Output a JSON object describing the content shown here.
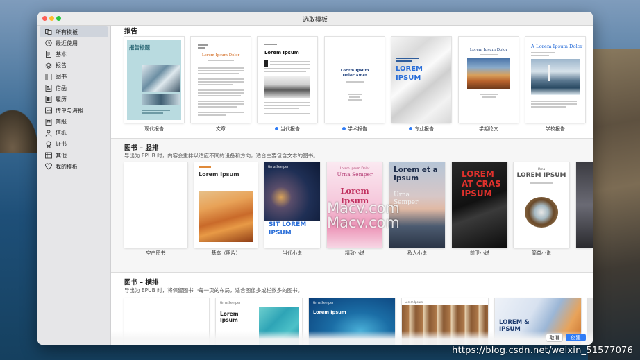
{
  "window": {
    "title": "选取模板",
    "buttons": {
      "cancel": "取消",
      "create": "创建"
    }
  },
  "sidebar": {
    "items": [
      {
        "label": "所有模板",
        "icon": "all-templates-icon",
        "active": true
      },
      {
        "label": "最近使用",
        "icon": "clock-icon"
      },
      {
        "label": "基本",
        "icon": "document-icon"
      },
      {
        "label": "报告",
        "icon": "stack-icon"
      },
      {
        "label": "图书",
        "icon": "book-icon"
      },
      {
        "label": "信函",
        "icon": "letter-icon"
      },
      {
        "label": "履历",
        "icon": "resume-icon"
      },
      {
        "label": "传单与海报",
        "icon": "poster-icon"
      },
      {
        "label": "简报",
        "icon": "newsletter-icon"
      },
      {
        "label": "信纸",
        "icon": "person-icon"
      },
      {
        "label": "证书",
        "icon": "certificate-icon"
      },
      {
        "label": "其他",
        "icon": "folder-icon"
      },
      {
        "label": "我的模板",
        "icon": "heart-icon"
      }
    ]
  },
  "sections": {
    "reports": {
      "title": "报告",
      "templates": [
        {
          "label": "现代报告",
          "new": false,
          "cover_text": "报告标题"
        },
        {
          "label": "文章",
          "new": false,
          "cover_text": "Lorem Ipsum Dolor"
        },
        {
          "label": "当代报告",
          "new": true,
          "cover_text": "Lorem Ipsum"
        },
        {
          "label": "学术报告",
          "new": true,
          "cover_text": "Lorem Ipsum Dolor Amet"
        },
        {
          "label": "专业报告",
          "new": true,
          "cover_text": "LOREM IPSUM"
        },
        {
          "label": "学期论文",
          "new": false,
          "cover_text": "Lorem Ipsum Dolor"
        },
        {
          "label": "学校报告",
          "new": false,
          "cover_text": "A Lorem Ipsum Dolor"
        }
      ]
    },
    "books_portrait": {
      "title": "图书 – 竖排",
      "description": "导出为 EPUB 时，内容会重排以适应不同的设备和方向，适合主要包含文本的图书。",
      "templates": [
        {
          "label": "空白图书",
          "cover_text": ""
        },
        {
          "label": "基本（照片）",
          "cover_text": "Lorem Ipsum"
        },
        {
          "label": "当代小说",
          "cover_text": "SIT LOREM IPSUM",
          "author": "Urna Semper"
        },
        {
          "label": "精致小说",
          "cover_text": "Lorem Ipsum",
          "author": "Urna Semper"
        },
        {
          "label": "私人小说",
          "cover_text": "Lorem et a Ipsum",
          "author": "Urna Semper"
        },
        {
          "label": "前卫小说",
          "cover_text": "LOREM AT CRAS IPSUM"
        },
        {
          "label": "简单小说",
          "cover_text": "LOREM IPSUM",
          "author": "Urna"
        }
      ]
    },
    "books_landscape": {
      "title": "图书 – 横排",
      "description": "导出为 EPUB 时，将保留图书中每一页的布局，适合图像多或栏数多的图书。",
      "templates": [
        {
          "cover_text": ""
        },
        {
          "cover_text": "Lorem Ipsum",
          "author": "Urna Semper"
        },
        {
          "cover_text": "Lorem Ipsum",
          "author": "Urna Semper"
        },
        {
          "cover_text": "Lorem Ipsum"
        },
        {
          "cover_text": "LOREM & IPSUM"
        }
      ]
    }
  },
  "desktop": {
    "watermark": "https://blog.csdn.net/weixin_51577076",
    "overlay_line1": "Macv.com",
    "overlay_line2": "Macv.com"
  },
  "colors": {
    "accent": "#2f7cf6",
    "sidebar_bg": "#e6e6e8"
  }
}
